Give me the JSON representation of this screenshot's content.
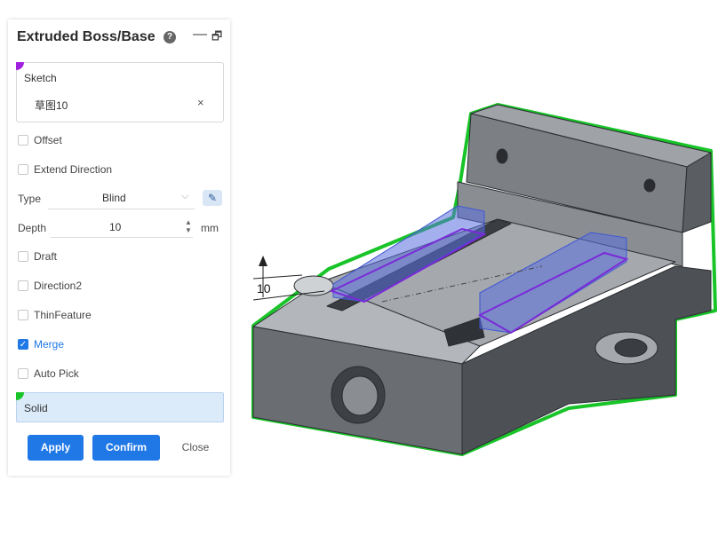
{
  "panel": {
    "title": "Extruded Boss/Base",
    "help_icon": "?",
    "minimize_icon": "—",
    "restore_icon": "🗗",
    "sketch": {
      "label": "Sketch",
      "value": "草图10",
      "clear_icon": "×"
    },
    "options": [
      {
        "label": "Offset",
        "checked": false
      },
      {
        "label": "Extend Direction",
        "checked": false
      }
    ],
    "type": {
      "label": "Type",
      "value": "Blind",
      "chevron": "⌵",
      "pick_icon": "✎"
    },
    "depth": {
      "label": "Depth",
      "value": "10",
      "unit": "mm",
      "stepper_up": "▲",
      "stepper_down": "▼"
    },
    "options2": [
      {
        "label": "Draft",
        "checked": false
      },
      {
        "label": "Direction2",
        "checked": false
      },
      {
        "label": "ThinFeature",
        "checked": false
      },
      {
        "label": "Merge",
        "checked": true
      },
      {
        "label": "Auto Pick",
        "checked": false
      }
    ],
    "solid": {
      "label": "Solid"
    },
    "buttons": {
      "apply": "Apply",
      "confirm": "Confirm",
      "close": "Close"
    },
    "check_mark": "✓"
  },
  "viewport": {
    "dimension_value": "10",
    "colors": {
      "part": "#6f7378",
      "selection": "#18c428",
      "preview": "#5a6fe0",
      "sketch_outline": "#7a2ad8"
    }
  }
}
